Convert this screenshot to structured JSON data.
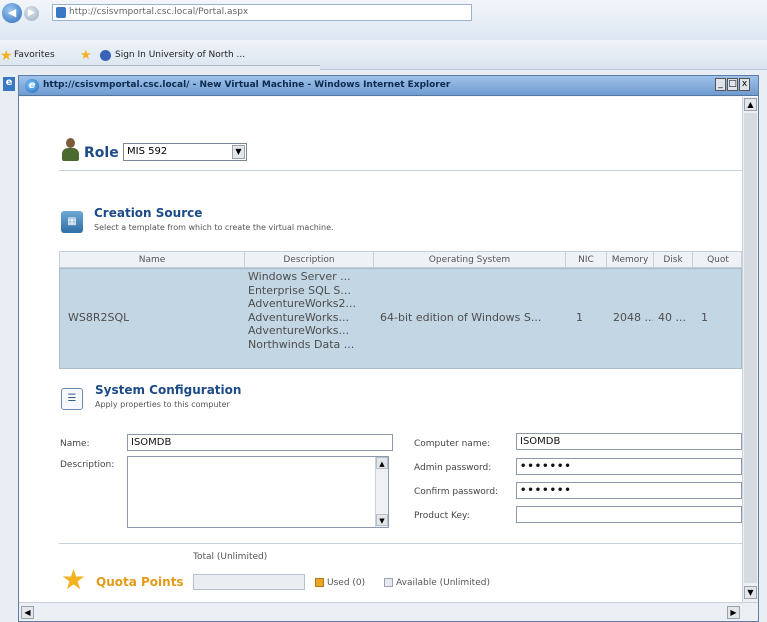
{
  "browser": {
    "url": "http://csisvmportal.csc.local/Portal.aspx",
    "favorites_label": "Favorites",
    "favorite_link": "Sign In University of North ..."
  },
  "popup": {
    "title": "http://csisvmportal.csc.local/ - New Virtual Machine - Windows Internet Explorer",
    "min_glyph": "_",
    "max_glyph": "□",
    "close_glyph": "x"
  },
  "role": {
    "label": "Role",
    "selected": "MIS 592"
  },
  "creation_source": {
    "title": "Creation Source",
    "subtitle": "Select a template from which to create the virtual machine.",
    "columns": [
      "Name",
      "Description",
      "Operating System",
      "NIC",
      "Memory",
      "Disk",
      "Quot"
    ],
    "row": {
      "name": "WS8R2SQL",
      "description": [
        "Windows Server ...",
        "Enterprise SQL S...",
        "AdventureWorks2...",
        "AdventureWorks...",
        "AdventureWorks...",
        "Northwinds Data ..."
      ],
      "os": "64-bit edition of Windows S...",
      "nic": "1",
      "memory": "2048 ...",
      "disk": "40 ...",
      "quota": "1"
    }
  },
  "system_config": {
    "title": "System Configuration",
    "subtitle": "Apply properties to this computer",
    "name_label": "Name:",
    "name_value": "ISOMDB",
    "description_label": "Description:",
    "computer_name_label": "Computer name:",
    "computer_name_value": "ISOMDB",
    "admin_password_label": "Admin password:",
    "admin_password_value": "•••••••",
    "confirm_password_label": "Confirm password:",
    "confirm_password_value": "•••••••",
    "product_key_label": "Product Key:"
  },
  "quota": {
    "title": "Quota Points",
    "total": "Total (Unlimited)",
    "used": "Used (0)",
    "available": "Available (Unlimited)"
  },
  "colors": {
    "heading_blue": "#1d4b86",
    "row_selected": "#c3d6e3",
    "quota_orange": "#e39a18"
  }
}
